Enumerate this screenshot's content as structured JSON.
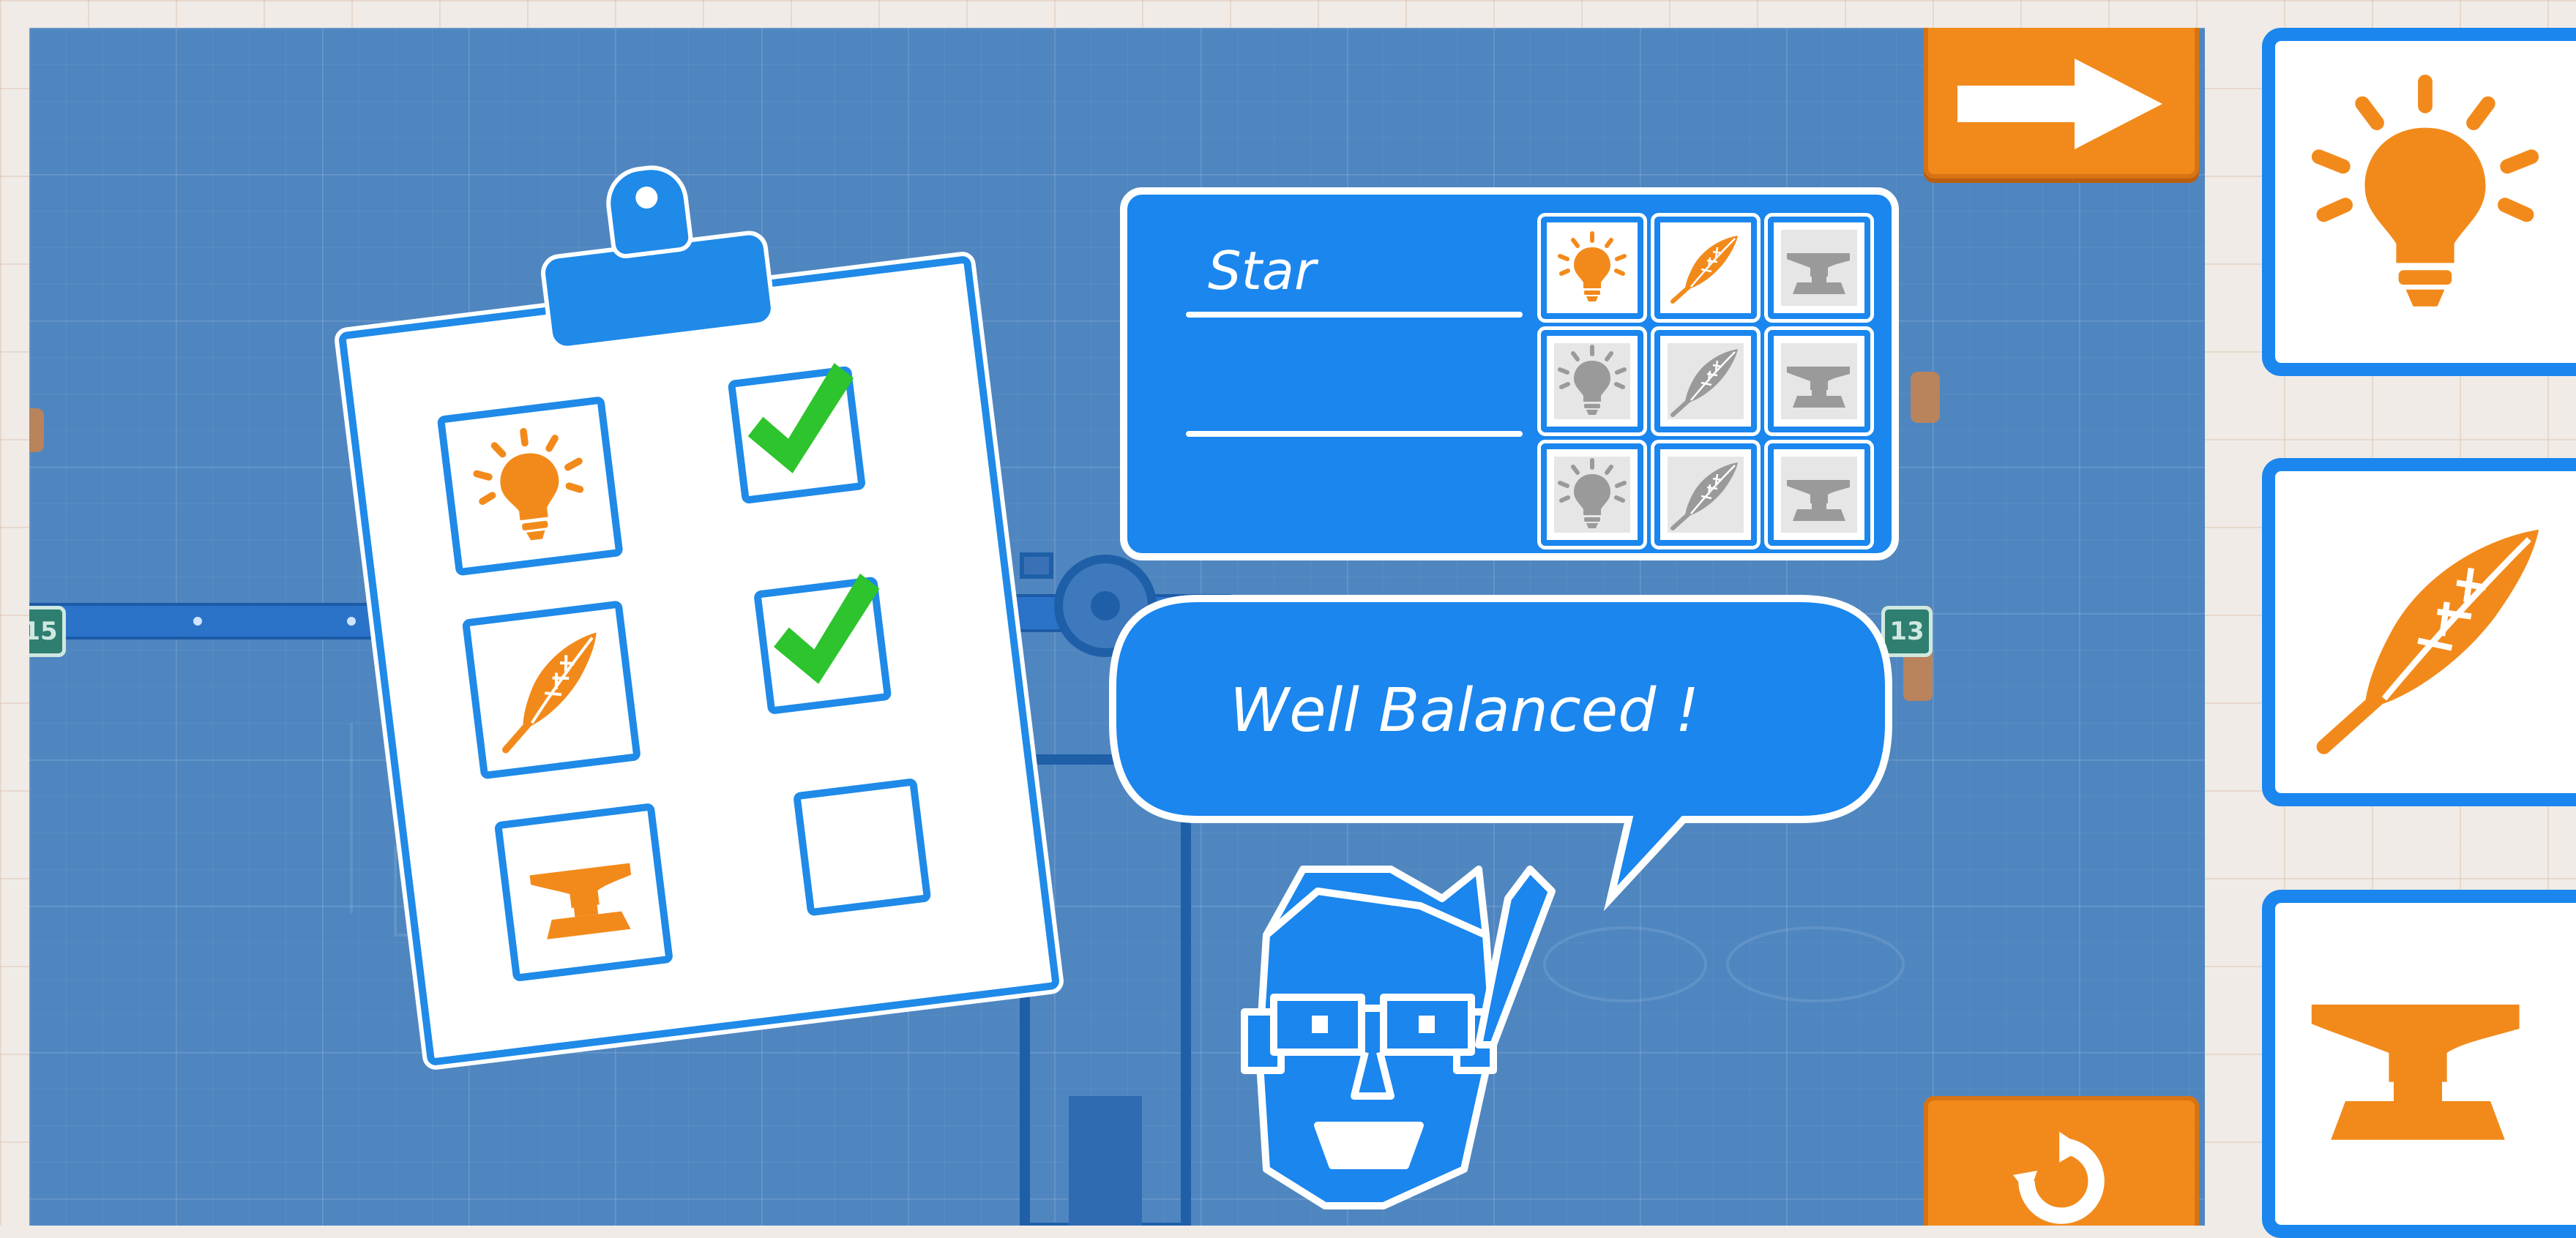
{
  "level_card": {
    "level_name": "Star",
    "blank_line_1": "",
    "blank_line_2": "",
    "rating_grid": [
      [
        "lightbulb-icon-active",
        "feather-icon-active",
        "anvil-icon-inactive"
      ],
      [
        "lightbulb-icon-inactive",
        "feather-icon-inactive",
        "anvil-icon-inactive"
      ],
      [
        "lightbulb-icon-inactive",
        "feather-icon-inactive",
        "anvil-icon-inactive"
      ]
    ]
  },
  "speech_bubble": {
    "text": "Well Balanced !"
  },
  "checklist": {
    "rows": [
      {
        "icon": "lightbulb-icon",
        "checked": true
      },
      {
        "icon": "feather-icon",
        "checked": true
      },
      {
        "icon": "anvil-icon",
        "checked": false
      }
    ]
  },
  "buttons": {
    "next": "arrow-right-icon",
    "restart": "restart-icon"
  },
  "side_panel": {
    "items": [
      "lightbulb-icon",
      "feather-icon",
      "anvil-icon"
    ]
  },
  "hud": {
    "left_marker": "15",
    "right_marker": "13"
  },
  "colors": {
    "board_blue": "#4f86c0",
    "panel_blue": "#1a86ee",
    "accent_orange": "#f28a1b",
    "check_green": "#2ec42e",
    "inactive_gray": "#9a9a9a"
  }
}
